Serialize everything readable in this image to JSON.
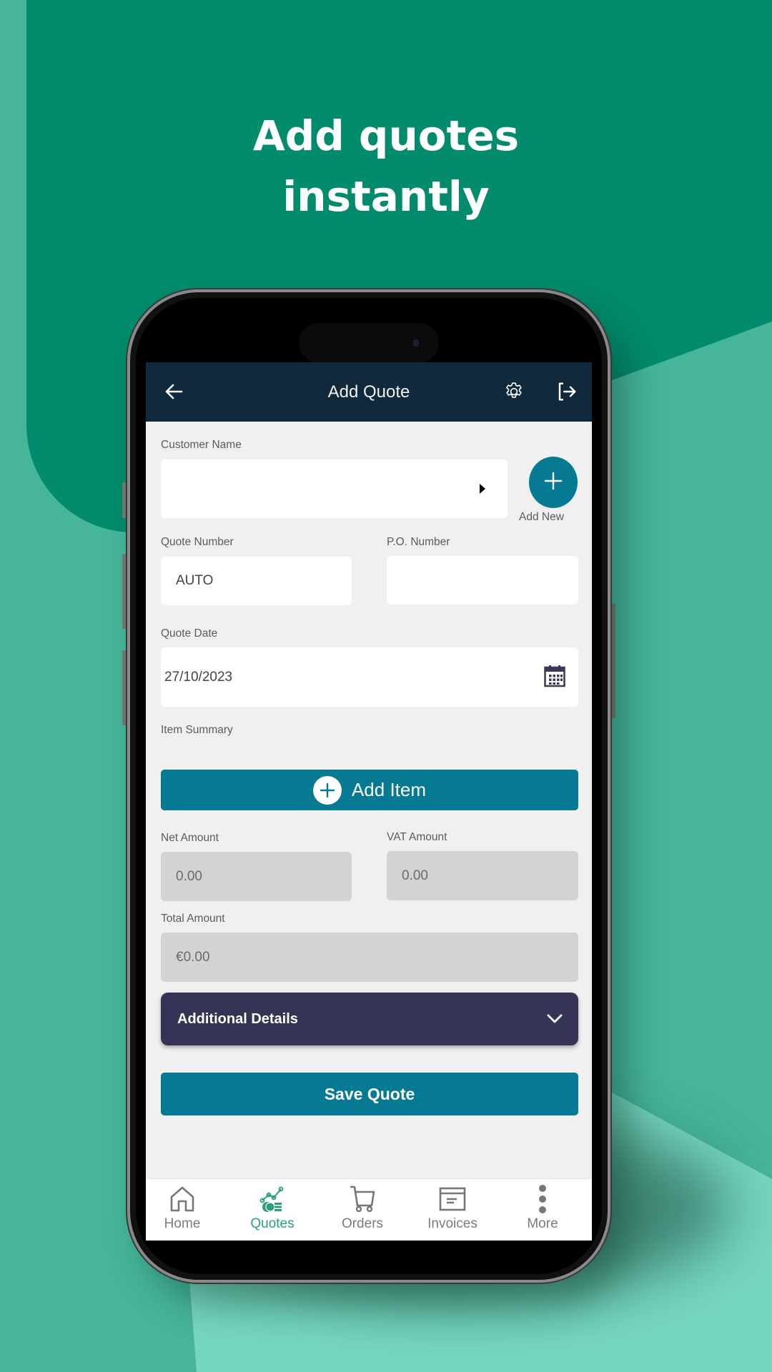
{
  "promo": {
    "headline_line1": "Add quotes",
    "headline_line2": "instantly"
  },
  "colors": {
    "bg_dark_green": "#028b6c",
    "bg_mid_green": "#46b59a",
    "bg_mint": "#75d6be",
    "appbar": "#10293c",
    "primary_teal": "#067a93",
    "details_purple": "#353456",
    "nav_active": "#2a9f7d"
  },
  "appbar": {
    "title": "Add Quote",
    "back_icon": "arrow-left-icon",
    "settings_icon": "gear-icon",
    "logout_icon": "logout-icon"
  },
  "form": {
    "customer_name": {
      "label": "Customer Name",
      "value": "",
      "dropdown_icon": "caret-right-icon"
    },
    "add_new": {
      "label": "Add New",
      "icon": "plus-icon"
    },
    "quote_number": {
      "label": "Quote Number",
      "value": "AUTO"
    },
    "po_number": {
      "label": "P.O. Number",
      "value": ""
    },
    "quote_date": {
      "label": "Quote Date",
      "value": "27/10/2023",
      "icon": "calendar-icon"
    },
    "item_summary": {
      "label": "Item Summary"
    },
    "add_item": {
      "label": "Add Item",
      "icon": "plus-circle-icon"
    },
    "net_amount": {
      "label": "Net Amount",
      "value": "0.00"
    },
    "vat_amount": {
      "label": "VAT Amount",
      "value": "0.00"
    },
    "total_amount": {
      "label": "Total Amount",
      "value": "€0.00"
    },
    "additional_details": {
      "label": "Additional Details",
      "icon": "chevron-down-icon"
    },
    "save": {
      "label": "Save Quote"
    }
  },
  "bottom_nav": {
    "items": [
      {
        "label": "Home",
        "icon": "home-icon",
        "active": false
      },
      {
        "label": "Quotes",
        "icon": "quotes-icon",
        "active": true
      },
      {
        "label": "Orders",
        "icon": "cart-icon",
        "active": false
      },
      {
        "label": "Invoices",
        "icon": "invoice-icon",
        "active": false
      },
      {
        "label": "More",
        "icon": "more-vertical-icon",
        "active": false
      }
    ]
  }
}
